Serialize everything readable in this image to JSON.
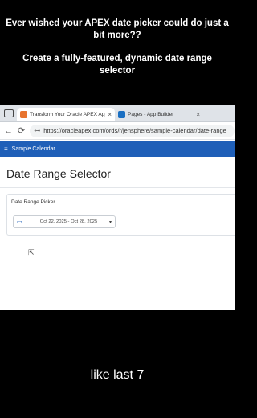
{
  "caption": {
    "line1": "Ever wished your APEX date picker could do just a bit more??",
    "line2": "Create a fully-featured, dynamic date range selector",
    "subtitle": "like last 7"
  },
  "browser": {
    "tabs": [
      {
        "label": "Transform Your Oracle APEX App",
        "icon": "oracle-favicon",
        "close": "×",
        "active": true
      },
      {
        "label": "Pages - App Builder",
        "icon": "apex-favicon",
        "close": "×",
        "active": false
      }
    ],
    "back_glyph": "←",
    "reload_glyph": "⟳",
    "site_icon_glyph": "⊶",
    "url": "https://oracleapex.com/ords/r/jensphere/sample-calendar/date-range"
  },
  "app": {
    "menu_glyph": "≡",
    "name": "Sample Calendar",
    "page_title": "Date Range Selector",
    "region_label": "Date Range Picker",
    "picker": {
      "calendar_glyph": "▭",
      "value": "Oct 22, 2025 - Oct 28, 2025",
      "chevron_glyph": "▾"
    }
  },
  "cursor_glyph": "⇱",
  "colors": {
    "header_blue": "#1f5fb8",
    "background": "#000000"
  }
}
